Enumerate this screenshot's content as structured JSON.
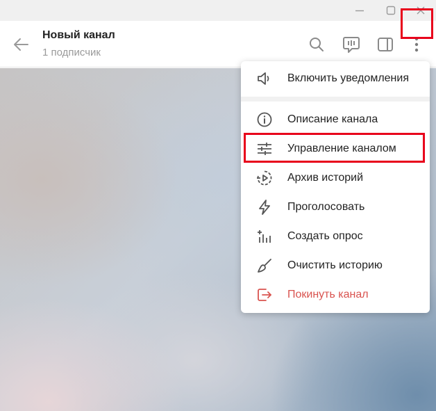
{
  "window": {
    "controls": [
      "minimize-icon",
      "maximize-icon",
      "close-icon"
    ]
  },
  "header": {
    "title": "Новый канал",
    "subtitle": "1 подписчик",
    "icons": [
      "back-arrow-icon",
      "search-icon",
      "chat-icon",
      "sidebar-icon",
      "more-vertical-icon"
    ]
  },
  "menu": {
    "items": [
      {
        "label": "Включить уведомления",
        "icon": "speaker-icon"
      },
      {
        "label": "Описание канала",
        "icon": "info-icon"
      },
      {
        "label": "Управление каналом",
        "icon": "sliders-icon"
      },
      {
        "label": "Архив историй",
        "icon": "stories-archive-icon"
      },
      {
        "label": "Проголосовать",
        "icon": "boost-icon"
      },
      {
        "label": "Создать опрос",
        "icon": "poll-icon"
      },
      {
        "label": "Очистить историю",
        "icon": "broom-icon"
      },
      {
        "label": "Покинуть канал",
        "icon": "leave-icon"
      }
    ]
  },
  "colors": {
    "highlight": "#e8001b",
    "danger": "#d9534f",
    "icon": "#8a8a8a"
  }
}
